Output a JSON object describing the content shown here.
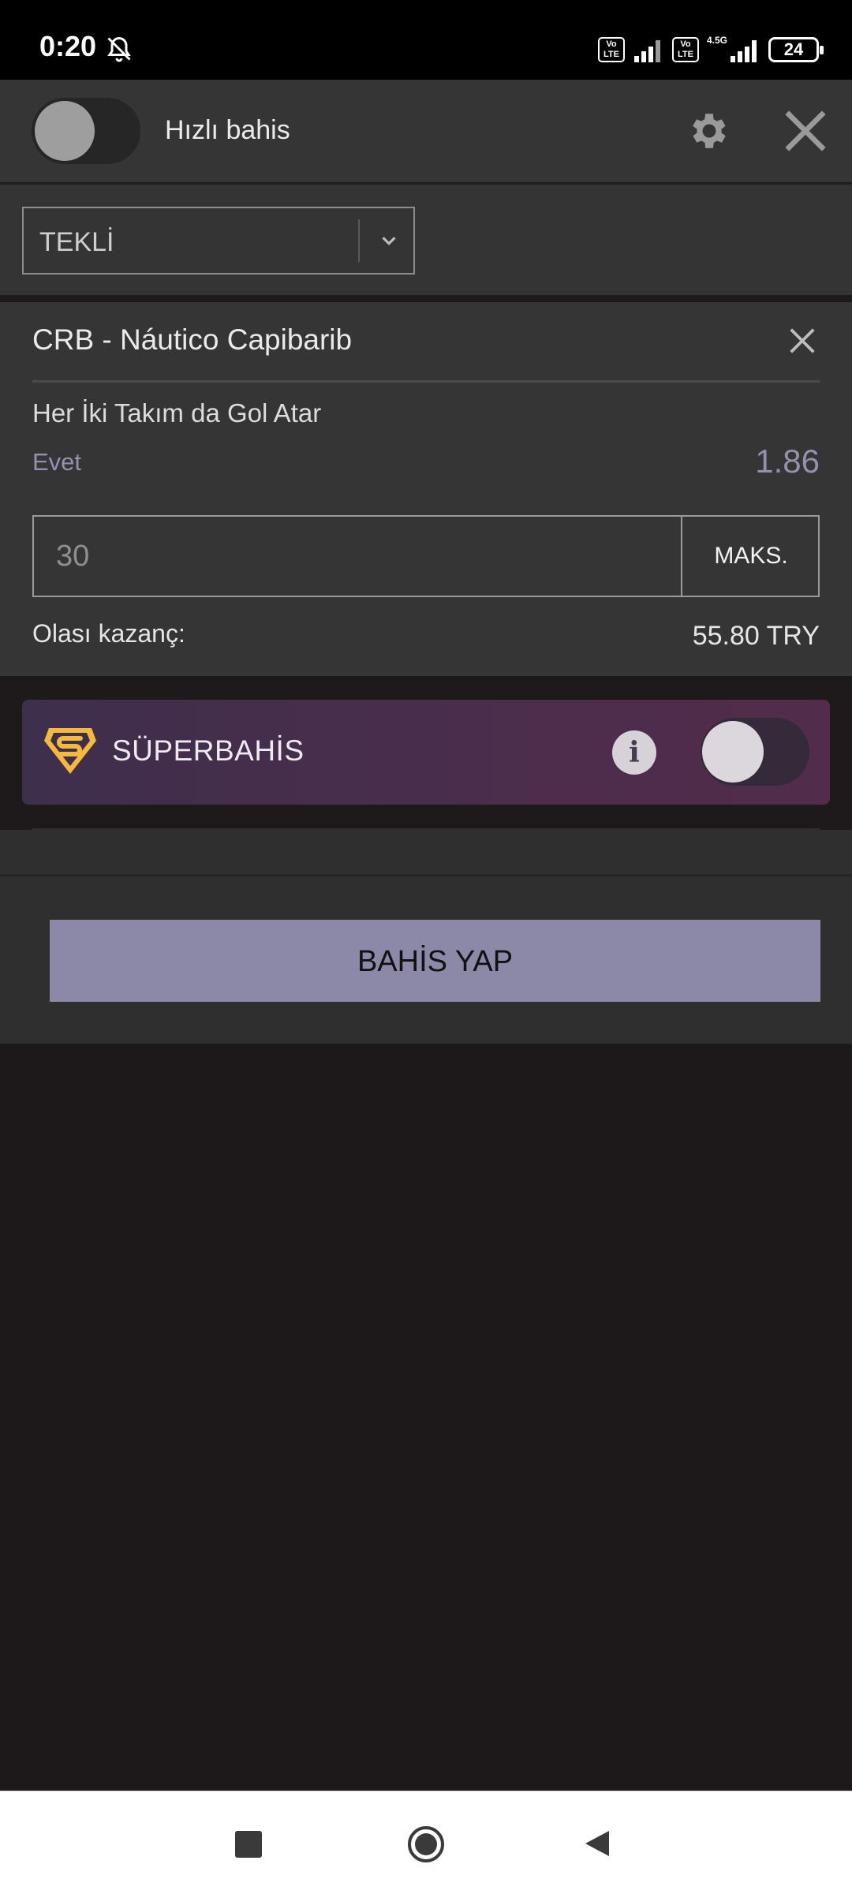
{
  "status_bar": {
    "time": "0:20",
    "network_label": "4.5G",
    "volte_1": "Vo LTE",
    "volte_2": "Vo LTE",
    "battery": "24"
  },
  "header": {
    "quick_bet_label": "Hızlı bahis",
    "quick_bet_enabled": false
  },
  "bet_type": {
    "selected": "TEKLİ"
  },
  "bet": {
    "match": "CRB - Náutico Capibarib",
    "market": "Her İki Takım da Gol Atar",
    "selection": "Evet",
    "odds": "1.86",
    "stake_placeholder": "30",
    "max_label": "MAKS.",
    "potential_win_label": "Olası kazanç:",
    "potential_win_value": "55.80 TRY"
  },
  "superbahis": {
    "title": "SÜPERBAHİS",
    "enabled": false
  },
  "actions": {
    "place_bet": "BAHİS YAP"
  },
  "colors": {
    "accent": "#8c88a8",
    "odds": "#9690ae",
    "banner_start": "#3e2f4c",
    "banner_end": "#532c4b",
    "logo_gold": "#f5b93e"
  }
}
